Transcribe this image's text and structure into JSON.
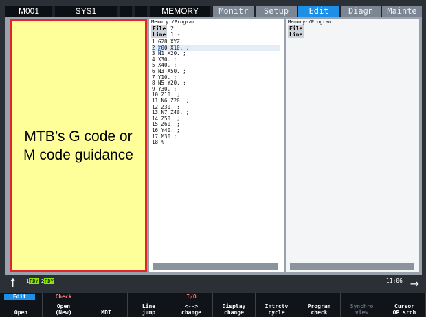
{
  "topbar": {
    "device": "M001",
    "system": "SYS1",
    "mode": "MEMORY",
    "tabs": [
      "Monitr",
      "Setup",
      "Edit",
      "Diagn",
      "Mainte"
    ],
    "active_tab": "Edit"
  },
  "guidance": {
    "line1": "MTB’s G code or",
    "line2": "M code guidance"
  },
  "program_pane": {
    "path": "Memory:/Program",
    "file_label": "File",
    "file_value": "2",
    "line_label": "Line",
    "line_value": "1 -",
    "lines": [
      "1 G28 XYZ;",
      "2 G00 X10. ;",
      "3 N1 X20. ;",
      "4 X30. ;",
      "5 X40. ;",
      "6 N3 X50. ;",
      "7 Y10. ;",
      "8 N5 Y20. ;",
      "9 Y30. ;",
      "10 Z10. ;",
      "11 N6 Z20. ;",
      "12 Z30. ;",
      "13 N7 Z40. ;",
      "14 Z50. ;",
      "15 Z60. ;",
      "16 Y40. ;",
      "17 M30 ;",
      "18 %"
    ]
  },
  "second_pane": {
    "path": "Memory:/Program",
    "file_label": "File",
    "line_label": "Line"
  },
  "status": {
    "rdy1_num": "1",
    "rdy1_text": "RDY",
    "rdy2_num": "2",
    "rdy2_text": "RDY",
    "clock": "11:06"
  },
  "softkeys": [
    {
      "top": "Edit",
      "bottom": "Open"
    },
    {
      "top": "Check",
      "bottom": "Open\n(New)"
    },
    {
      "top": "",
      "bottom": "MDI"
    },
    {
      "top": "",
      "bottom": "Line\njump"
    },
    {
      "top": "I/O",
      "bottom": "<-->\nchange"
    },
    {
      "top": "",
      "bottom": "Display\nchange"
    },
    {
      "top": "",
      "bottom": "Intrctv\ncycle"
    },
    {
      "top": "",
      "bottom": "Program\ncheck"
    },
    {
      "top": "",
      "bottom": "Synchro\nview"
    },
    {
      "top": "",
      "bottom": "Cursor\nOP srch"
    }
  ],
  "colors": {
    "accent": "#1e8fe6",
    "guidance_bg": "#ffff99",
    "guidance_border": "#e1262b",
    "rdy": "#88e800"
  }
}
